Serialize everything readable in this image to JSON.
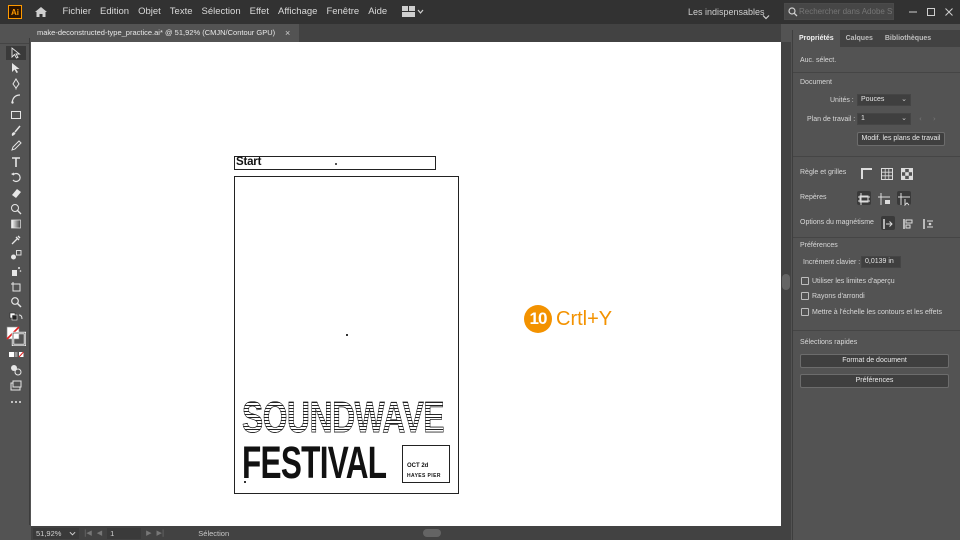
{
  "app": {
    "logo_text": "Ai"
  },
  "menu": [
    "Fichier",
    "Edition",
    "Objet",
    "Texte",
    "Sélection",
    "Effet",
    "Affichage",
    "Fenêtre",
    "Aide"
  ],
  "workspace": {
    "label": "Les indispensables"
  },
  "search": {
    "placeholder": "Rechercher dans Adobe Stock"
  },
  "document_tab": {
    "title": "make-deconstructed-type_practice.ai* @ 51,92% (CMJN/Contour GPU)",
    "close": "×"
  },
  "canvas": {
    "start_label": "Start",
    "title_outline": "SOUNDWAVE",
    "title_solid": "FESTIVAL",
    "info_date": "OCT 2d",
    "info_place": "HAYES PIER"
  },
  "step": {
    "number": "10",
    "shortcut": "Crtl+Y",
    "color": "#f39200"
  },
  "status": {
    "zoom": "51,92%",
    "page": "1",
    "tool": "Sélection"
  },
  "panel": {
    "tabs": [
      "Propriétés",
      "Calques",
      "Bibliothèques"
    ],
    "no_selection": "Auc. sélect.",
    "document_heading": "Document",
    "units_label": "Unités :",
    "units_value": "Pouces",
    "artboard_label": "Plan de travail :",
    "artboard_value": "1",
    "edit_artboards_button": "Modif. les plans de travail",
    "rulers_label": "Règle et grilles",
    "guides_label": "Repères",
    "snap_label": "Options du magnétisme",
    "preferences_heading": "Préférences",
    "keyboard_increment_label": "Incrément clavier :",
    "keyboard_increment_value": "0,0139 in",
    "checkbox_preview_bounds": "Utiliser les limites d'aperçu",
    "checkbox_rounded_corners": "Rayons d'arrondi",
    "checkbox_scale_strokes": "Mettre à l'échelle les contours et les effets",
    "quick_actions_heading": "Sélections rapides",
    "document_setup_button": "Format de document",
    "preferences_button": "Préférences"
  }
}
